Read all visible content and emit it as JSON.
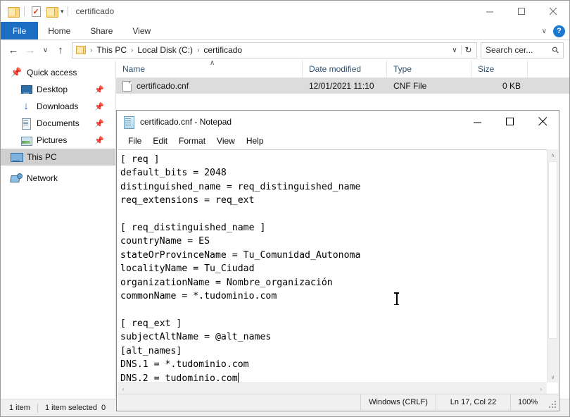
{
  "explorer": {
    "title": "certificado",
    "quick_access_toolbar": [
      {
        "name": "folder-icon",
        "label": ""
      },
      {
        "name": "properties-icon",
        "label": ""
      },
      {
        "name": "new-folder-icon",
        "label": ""
      },
      {
        "name": "chevron-down-icon",
        "label": "▾"
      }
    ],
    "window_controls": {
      "minimize": "—",
      "maximize": "☐",
      "close": "✕"
    },
    "ribbon_tabs": [
      {
        "label": "File"
      },
      {
        "label": "Home"
      },
      {
        "label": "Share"
      },
      {
        "label": "View"
      }
    ],
    "ribbon_right": {
      "collapse": "∨",
      "help": "?"
    },
    "address_bar": {
      "back": "←",
      "forward": "→",
      "recent": "∨",
      "up": "↑",
      "crumbs": [
        "This PC",
        "Local Disk (C:)",
        "certificado"
      ],
      "separator": "›",
      "dropdown": "∨",
      "refresh": "↻"
    },
    "search": {
      "placeholder": "Search cer...",
      "icon": "search-icon",
      "value": "Search cer..."
    },
    "nav_pane": [
      {
        "label": "Quick access",
        "icon": "star-pin-icon",
        "indent": false,
        "pinned": false,
        "selected": false
      },
      {
        "label": "Desktop",
        "icon": "desktop-icon",
        "indent": true,
        "pinned": true,
        "selected": false
      },
      {
        "label": "Downloads",
        "icon": "downloads-icon",
        "indent": true,
        "pinned": true,
        "selected": false
      },
      {
        "label": "Documents",
        "icon": "documents-icon",
        "indent": true,
        "pinned": true,
        "selected": false
      },
      {
        "label": "Pictures",
        "icon": "pictures-icon",
        "indent": true,
        "pinned": true,
        "selected": false
      },
      {
        "label": "This PC",
        "icon": "this-pc-icon",
        "indent": false,
        "pinned": false,
        "selected": true
      },
      {
        "label": "Network",
        "icon": "network-icon",
        "indent": false,
        "pinned": false,
        "selected": false
      }
    ],
    "columns": [
      {
        "label": "Name"
      },
      {
        "label": "Date modified"
      },
      {
        "label": "Type"
      },
      {
        "label": "Size"
      }
    ],
    "sort_indicator": "∧",
    "files": [
      {
        "name": "certificado.cnf",
        "date_modified": "12/01/2021 11:10",
        "type": "CNF File",
        "size": "0 KB",
        "selected": true
      }
    ],
    "status": {
      "item_count": "1 item",
      "selection": "1 item selected",
      "selection_size": "0 "
    }
  },
  "notepad": {
    "title": "certificado.cnf - Notepad",
    "icon": "notepad-icon",
    "window_controls": {
      "minimize": "—",
      "maximize": "☐",
      "close": "✕"
    },
    "menus": [
      {
        "label": "File"
      },
      {
        "label": "Edit"
      },
      {
        "label": "Format"
      },
      {
        "label": "View"
      },
      {
        "label": "Help"
      }
    ],
    "content": "[ req ]\ndefault_bits = 2048\ndistinguished_name = req_distinguished_name\nreq_extensions = req_ext\n\n[ req_distinguished_name ]\ncountryName = ES\nstateOrProvinceName = Tu_Comunidad_Autonoma\nlocalityName = Tu_Ciudad\norganizationName = Nombre_organización\ncommonName = *.tudominio.com\n\n[ req_ext ]\nsubjectAltName = @alt_names\n[alt_names]\nDNS.1 = *.tudominio.com\nDNS.2 = tudominio.com",
    "scrollbar": {
      "up": "∧",
      "down": "∨",
      "left": "‹",
      "right": "›"
    },
    "status": {
      "line_ending": "Windows (CRLF)",
      "cursor": "Ln 17, Col 22",
      "zoom": "100%"
    }
  }
}
